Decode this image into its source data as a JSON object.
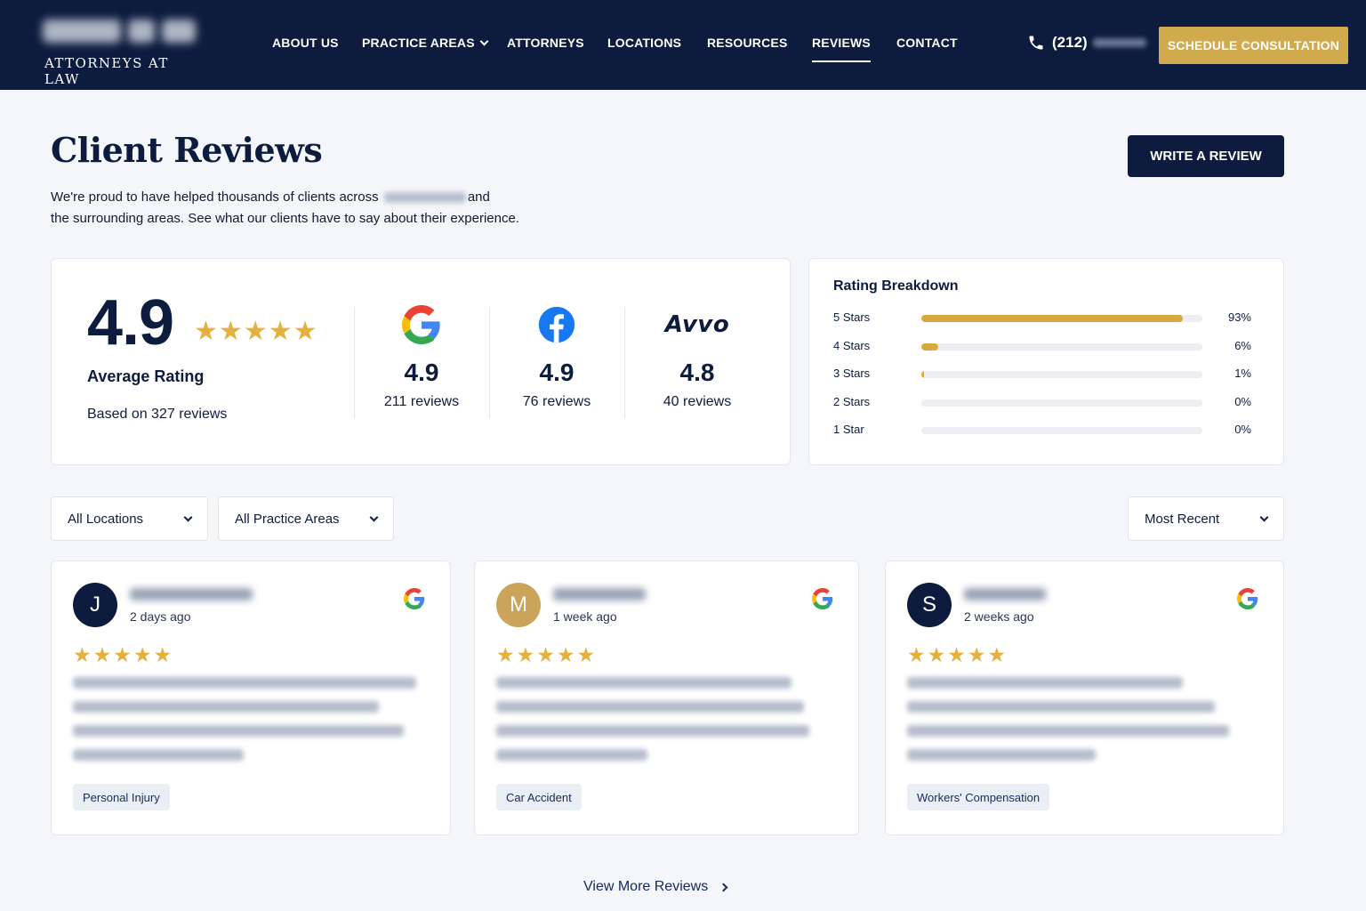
{
  "header": {
    "logo_tagline": "ATTORNEYS AT LAW",
    "nav": [
      {
        "label": "ABOUT US"
      },
      {
        "label": "PRACTICE AREAS"
      },
      {
        "label": "ATTORNEYS"
      },
      {
        "label": "LOCATIONS"
      },
      {
        "label": "RESOURCES"
      },
      {
        "label": "REVIEWS"
      },
      {
        "label": "CONTACT"
      }
    ],
    "phone_prefix": "(212)",
    "cta_label": "SCHEDULE CONSULTATION"
  },
  "page": {
    "title": "Client Reviews",
    "intro_line1_a": "We're proud to have helped thousands of clients across",
    "intro_line1_b": "and",
    "intro_line2": "the surrounding areas. See what our clients have to say about their experience.",
    "write_review_label": "WRITE A REVIEW"
  },
  "summary": {
    "average": "4.9",
    "stars": "★★★★★",
    "average_label": "Average Rating",
    "based_on": "Based on 327 reviews",
    "platforms": [
      {
        "name": "google",
        "rating": "4.9",
        "count": "211 reviews"
      },
      {
        "name": "facebook",
        "rating": "4.9",
        "count": "76 reviews"
      },
      {
        "name": "Avvo",
        "rating": "4.8",
        "count": "40 reviews"
      }
    ]
  },
  "breakdown": {
    "title": "Rating Breakdown",
    "rows": [
      {
        "label": "5 Stars",
        "pct_label": "93%",
        "fraction": 0.93
      },
      {
        "label": "4 Stars",
        "pct_label": "6%",
        "fraction": 0.06
      },
      {
        "label": "3 Stars",
        "pct_label": "1%",
        "fraction": 0.01
      },
      {
        "label": "2 Stars",
        "pct_label": "0%",
        "fraction": 0
      },
      {
        "label": "1 Star",
        "pct_label": "0%",
        "fraction": 0
      }
    ],
    "fill_color": "#d9a83e"
  },
  "filters": {
    "location": "All Locations",
    "practice_area": "All Practice Areas",
    "sort": "Most Recent"
  },
  "reviews": [
    {
      "initial": "J",
      "avatar_color": "#0d1b3e",
      "date": "2 days ago",
      "stars": "★★★★★",
      "tag": "Personal Injury"
    },
    {
      "initial": "M",
      "avatar_color": "#c9a45a",
      "date": "1 week ago",
      "stars": "★★★★★",
      "tag": "Car Accident"
    },
    {
      "initial": "S",
      "avatar_color": "#0d1b3e",
      "date": "2 weeks ago",
      "stars": "★★★★★",
      "tag": "Workers' Compensation"
    }
  ],
  "view_more_label": "View More Reviews",
  "colors": {
    "navy": "#0d1b3e",
    "gold": "#d2aa4e",
    "star": "#e4b13f"
  }
}
